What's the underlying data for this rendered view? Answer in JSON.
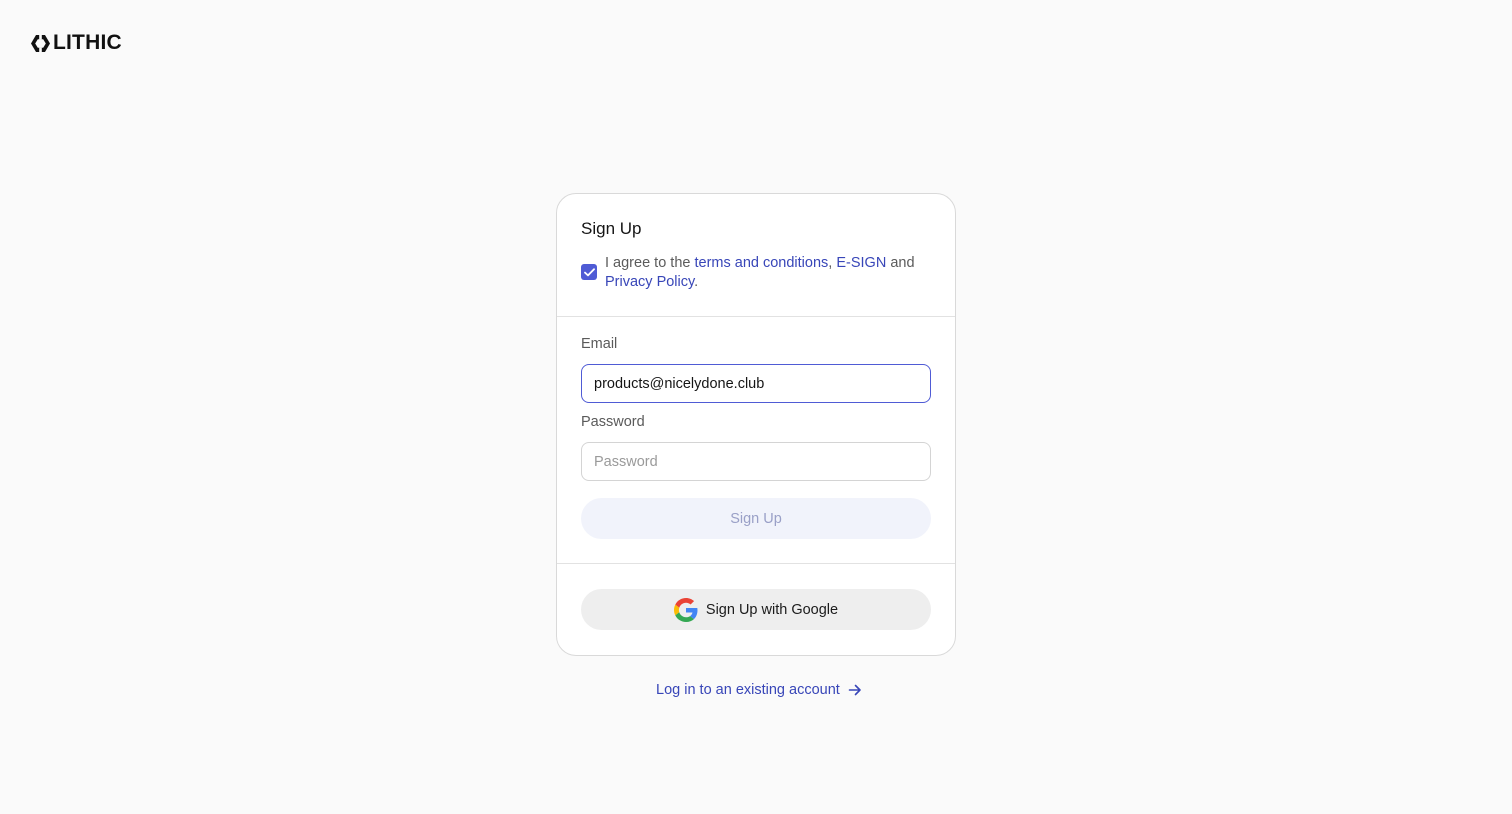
{
  "brand": {
    "name": "LITHIC",
    "logo_icon": "lithic-logo-icon"
  },
  "signup": {
    "title": "Sign Up",
    "agreement": {
      "checked": true,
      "prefix": "I agree to the ",
      "terms_link": "terms and conditions",
      "comma": ", ",
      "esign_link": "E-SIGN",
      "and": " and ",
      "privacy_link": "Privacy Policy",
      "period": "."
    },
    "email": {
      "label": "Email",
      "value": "products@nicelydone.club"
    },
    "password": {
      "label": "Password",
      "placeholder": "Password",
      "value": ""
    },
    "submit_label": "Sign Up",
    "google_label": "Sign Up with Google"
  },
  "login_link": "Log in to an existing account",
  "colors": {
    "accent": "#4f5bd5",
    "link": "#3846b8",
    "disabled_button": "#f1f3fb"
  }
}
